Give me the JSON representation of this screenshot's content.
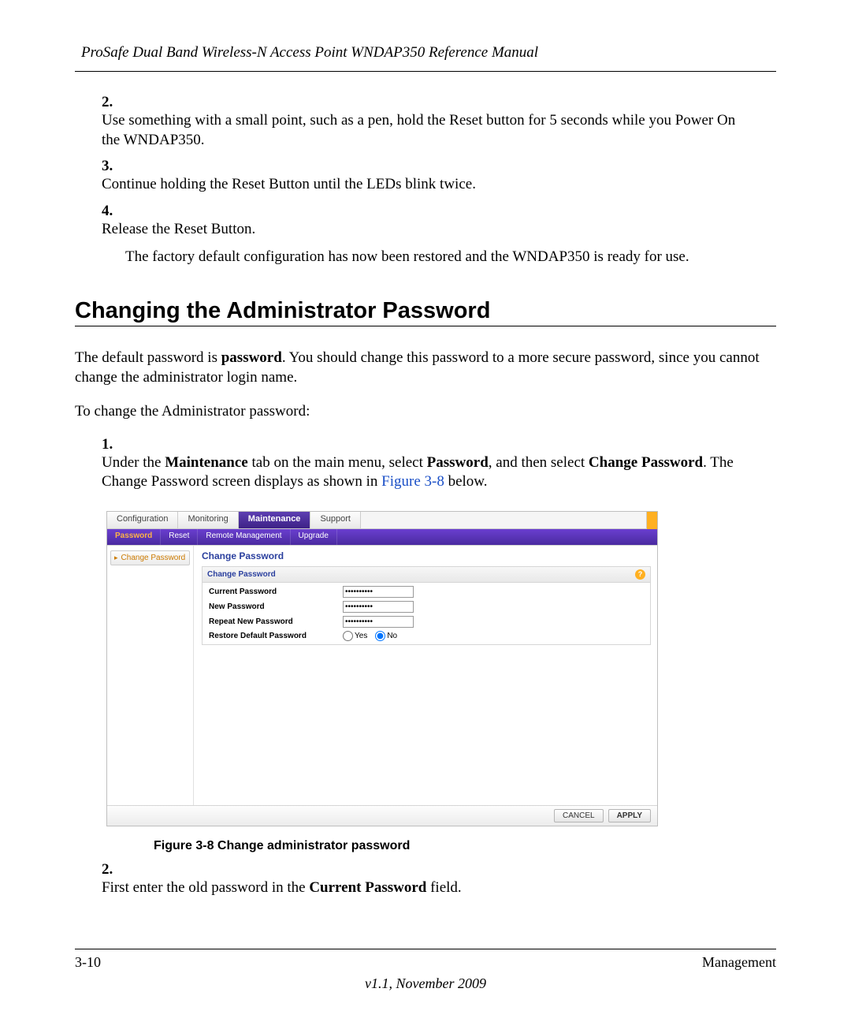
{
  "header": {
    "title": "ProSafe Dual Band Wireless-N Access Point WNDAP350 Reference Manual"
  },
  "steps_top": {
    "s2_num": "2.",
    "s2": "Use something with a small point, such as a pen, hold the Reset button for 5 seconds while you Power On the WNDAP350.",
    "s3_num": "3.",
    "s3": "Continue holding the Reset Button until the LEDs blink twice.",
    "s4_num": "4.",
    "s4": "Release the Reset Button.",
    "after": "The factory default configuration has now been restored and the WNDAP350 is ready for use."
  },
  "section_heading": "Changing the Administrator Password",
  "para1_a": "The default password is ",
  "para1_bold": "password",
  "para1_b": ". You should change this password to a more secure password, since you cannot change the administrator login name.",
  "para2": "To change the Administrator password:",
  "steps_mid": {
    "s1_num": "1.",
    "s1_a": "Under the ",
    "s1_b_bold": "Maintenance",
    "s1_c": " tab on the main menu, select ",
    "s1_d_bold": "Password",
    "s1_e": ", and then select ",
    "s1_f_bold": "Change Password",
    "s1_g": ". The Change Password screen displays as shown in ",
    "s1_link": "Figure 3-8",
    "s1_h": " below."
  },
  "app": {
    "tabs": {
      "config": "Configuration",
      "monitor": "Monitoring",
      "maint": "Maintenance",
      "support": "Support"
    },
    "subtabs": {
      "password": "Password",
      "reset": "Reset",
      "remote": "Remote Management",
      "upgrade": "Upgrade"
    },
    "sidebar": {
      "change_pw": "Change Password"
    },
    "content": {
      "title": "Change Password",
      "panel_title": "Change Password",
      "row_current": "Current Password",
      "row_new": "New Password",
      "row_repeat": "Repeat New Password",
      "row_restore": "Restore Default Password",
      "yes": "Yes",
      "no": "No",
      "pw_dots": "••••••••••"
    },
    "buttons": {
      "cancel": "CANCEL",
      "apply": "APPLY"
    },
    "help": "?"
  },
  "figure_caption": "Figure 3-8  Change administrator password",
  "steps_bottom": {
    "s2_num": "2.",
    "s2_a": "First enter the old password in the ",
    "s2_b_bold": "Current Password",
    "s2_c": " field."
  },
  "footer": {
    "page_num": "3-10",
    "section": "Management",
    "version": "v1.1, November 2009"
  }
}
